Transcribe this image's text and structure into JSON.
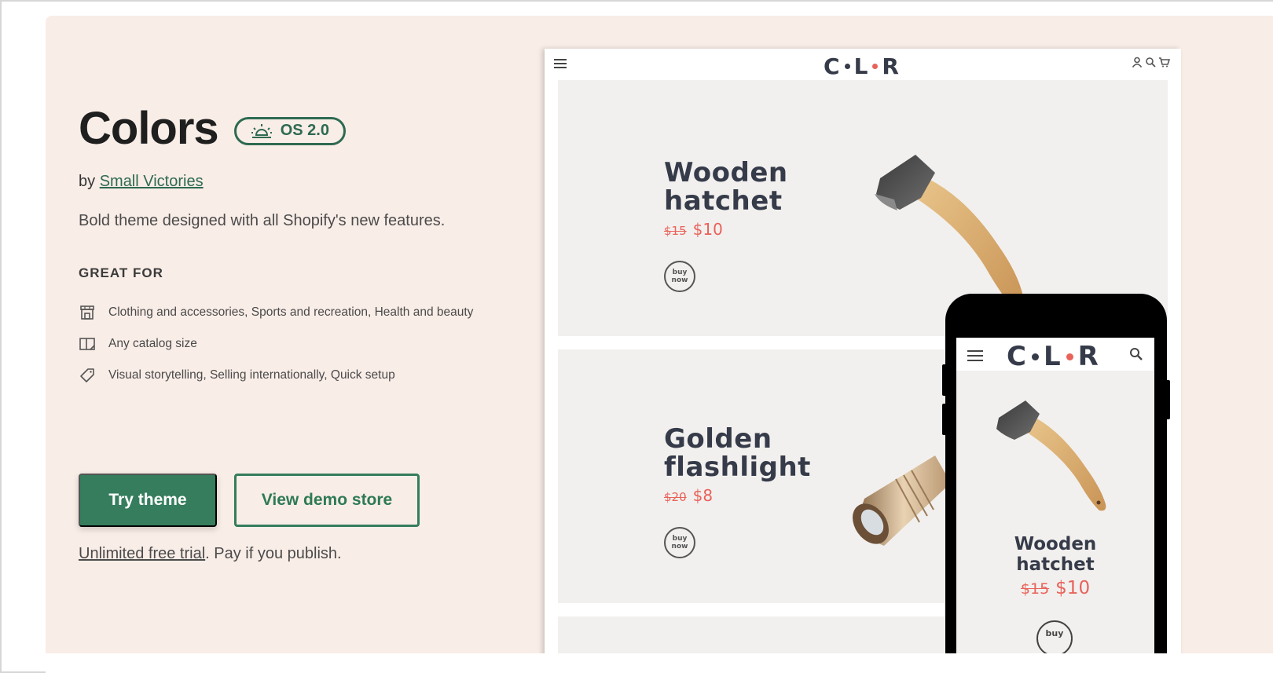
{
  "theme": {
    "title": "Colors",
    "badge": {
      "icon": "sunrise-icon",
      "label": "OS 2.0"
    },
    "byline_prefix": "by",
    "author": "Small Victories",
    "description": "Bold theme designed with all Shopify's new features.",
    "great_for_heading": "GREAT FOR",
    "features": [
      {
        "icon": "store-icon",
        "text": "Clothing and accessories, Sports and recreation, Health and beauty"
      },
      {
        "icon": "catalog-icon",
        "text": "Any catalog size"
      },
      {
        "icon": "tag-icon",
        "text": "Visual storytelling, Selling internationally, Quick setup"
      }
    ],
    "primary_button": "Try theme",
    "secondary_button": "View demo store",
    "trial_link": "Unlimited free trial",
    "trial_suffix": ". Pay if you publish."
  },
  "preview": {
    "logo": {
      "c": "C",
      "l": "L",
      "r": "R",
      "dot1_color": "#363b4a",
      "dot2_color": "#e8625a"
    },
    "desktop_icons": [
      "account-icon",
      "search-icon",
      "cart-icon"
    ],
    "products": [
      {
        "name_line1": "Wooden",
        "name_line2": "hatchet",
        "old_price": "$15",
        "new_price": "$10",
        "buy_line1": "buy",
        "buy_line2": "now"
      },
      {
        "name_line1": "Golden",
        "name_line2": "flashlight",
        "old_price": "$20",
        "new_price": "$8",
        "buy_line1": "buy",
        "buy_line2": "now"
      }
    ],
    "mobile": {
      "name_line1": "Wooden",
      "name_line2": "hatchet",
      "old_price": "$15",
      "new_price": "$10",
      "buy_label": "buy"
    }
  },
  "colors": {
    "brand_green": "#357d5c",
    "hero_background": "#f9ede7",
    "sale_red": "#e8625a",
    "heading_dark": "#363b4a"
  }
}
